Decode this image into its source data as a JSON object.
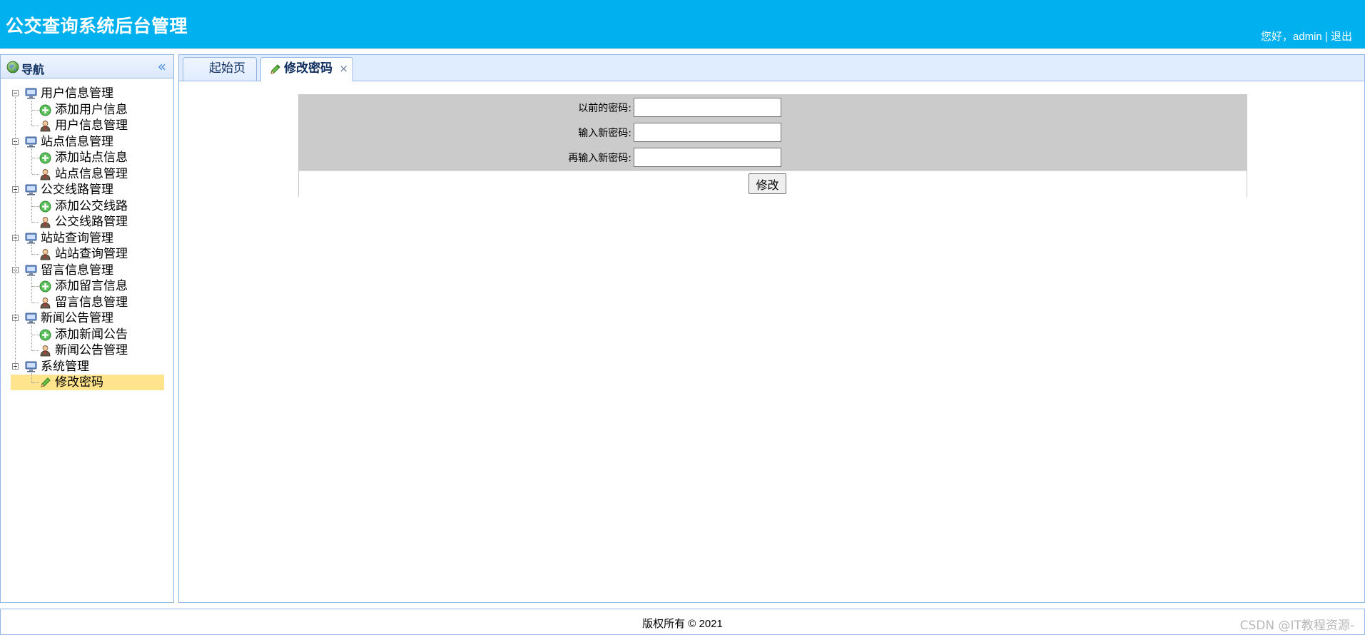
{
  "header": {
    "title": "公交查询系统后台管理",
    "greeting": "您好，admin",
    "separator": " | ",
    "logout": "退出"
  },
  "nav": {
    "title": "导航",
    "collapse_symbol": "«",
    "groups": [
      {
        "label": "用户信息管理",
        "children": [
          {
            "label": "添加用户信息",
            "icon": "add-icon"
          },
          {
            "label": "用户信息管理",
            "icon": "user-icon"
          }
        ]
      },
      {
        "label": "站点信息管理",
        "children": [
          {
            "label": "添加站点信息",
            "icon": "add-icon"
          },
          {
            "label": "站点信息管理",
            "icon": "user-icon"
          }
        ]
      },
      {
        "label": "公交线路管理",
        "children": [
          {
            "label": "添加公交线路",
            "icon": "add-icon"
          },
          {
            "label": "公交线路管理",
            "icon": "user-icon"
          }
        ]
      },
      {
        "label": "站站查询管理",
        "children": [
          {
            "label": "站站查询管理",
            "icon": "user-icon"
          }
        ]
      },
      {
        "label": "留言信息管理",
        "children": [
          {
            "label": "添加留言信息",
            "icon": "add-icon"
          },
          {
            "label": "留言信息管理",
            "icon": "user-icon"
          }
        ]
      },
      {
        "label": "新闻公告管理",
        "children": [
          {
            "label": "添加新闻公告",
            "icon": "add-icon"
          },
          {
            "label": "新闻公告管理",
            "icon": "user-icon"
          }
        ]
      },
      {
        "label": "系统管理",
        "children": [
          {
            "label": "修改密码",
            "icon": "pencil-icon",
            "selected": true
          }
        ]
      }
    ]
  },
  "tabs": {
    "home": "起始页",
    "active": "修改密码",
    "close": "×"
  },
  "form": {
    "old_password_label": "以前的密码:",
    "old_password_value": "",
    "new_password_label": "输入新密码:",
    "new_password_value": "",
    "confirm_password_label": "再输入新密码:",
    "confirm_password_value": "",
    "submit_label": "修改"
  },
  "footer": {
    "copyright": "版权所有 © 2021",
    "watermark": "CSDN @IT教程资源-"
  },
  "colors": {
    "header_bg": "#00b0ef",
    "panel_border": "#95b8e7",
    "tab_strip_bg": "#e0ecff",
    "selected_row": "#ffe48d",
    "form_bg": "#cbcbcb"
  }
}
